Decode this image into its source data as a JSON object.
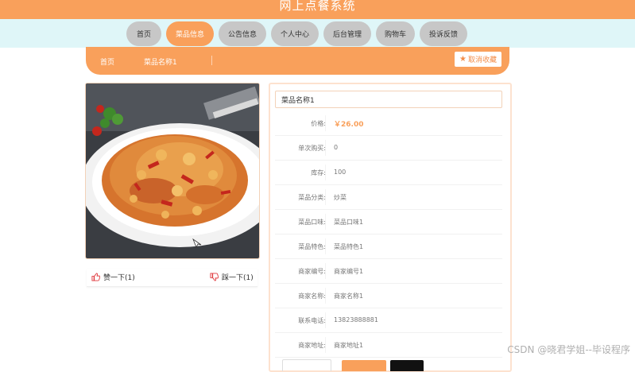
{
  "app": {
    "title": "网上点餐系统"
  },
  "nav": {
    "items": [
      {
        "label": "首页",
        "active": false
      },
      {
        "label": "菜品信息",
        "active": true
      },
      {
        "label": "公告信息",
        "active": false
      },
      {
        "label": "个人中心",
        "active": false
      },
      {
        "label": "后台管理",
        "active": false
      },
      {
        "label": "购物车",
        "active": false
      },
      {
        "label": "投诉反馈",
        "active": false
      }
    ]
  },
  "breadcrumb": {
    "home": "首页",
    "current": "菜品名称1",
    "unfavorite_label": "取消收藏"
  },
  "votes": {
    "like_label": "赞一下(1)",
    "dislike_label": "踩一下(1)"
  },
  "dish": {
    "name": "菜品名称1",
    "fields": [
      {
        "label": "价格:",
        "value": "￥26.00",
        "is_price": true
      },
      {
        "label": "单次购买:",
        "value": "0"
      },
      {
        "label": "库存:",
        "value": "100"
      },
      {
        "label": "菜品分类:",
        "value": "炒菜"
      },
      {
        "label": "菜品口味:",
        "value": "菜品口味1"
      },
      {
        "label": "菜品特色:",
        "value": "菜品特色1"
      },
      {
        "label": "商家编号:",
        "value": "商家编号1"
      },
      {
        "label": "商家名称:",
        "value": "商家名称1"
      },
      {
        "label": "联系电话:",
        "value": "13823888881"
      },
      {
        "label": "商家地址:",
        "value": "商家地址1"
      }
    ]
  },
  "watermark": "CSDN @晓君学姐--毕设程序",
  "colors": {
    "accent": "#f9a05b",
    "nav_bg": "#dff6f8",
    "nav_btn": "#c7c7c7"
  }
}
